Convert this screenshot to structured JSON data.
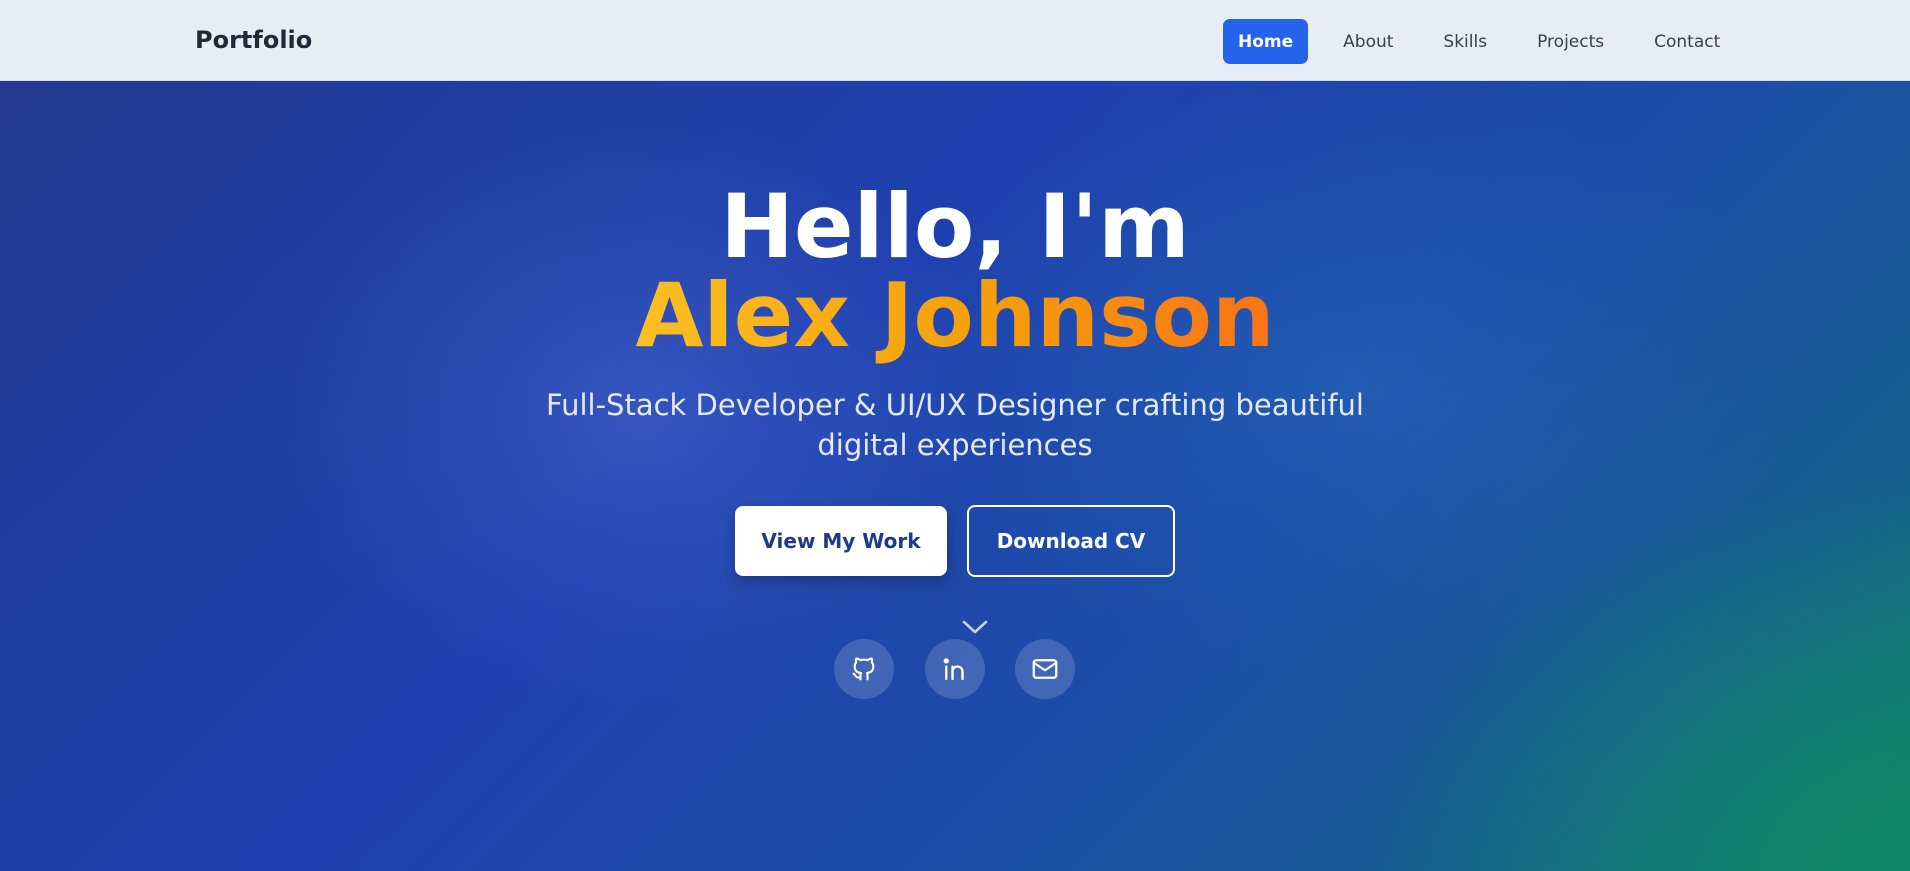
{
  "nav": {
    "brand": "Portfolio",
    "links": [
      {
        "label": "Home",
        "active": true
      },
      {
        "label": "About",
        "active": false
      },
      {
        "label": "Skills",
        "active": false
      },
      {
        "label": "Projects",
        "active": false
      },
      {
        "label": "Contact",
        "active": false
      }
    ]
  },
  "hero": {
    "greeting": "Hello, I'm",
    "name": "Alex Johnson",
    "subtitle": "Full-Stack Developer & UI/UX Designer crafting beautiful digital experiences",
    "primary_button": "View My Work",
    "secondary_button": "Download CV",
    "scroll_icon": "chevron-down-icon",
    "social": [
      {
        "icon": "github-icon"
      },
      {
        "icon": "linkedin-icon"
      },
      {
        "icon": "mail-icon"
      }
    ]
  },
  "colors": {
    "accent": "#2563eb",
    "name_gradient_start": "#fbbf24",
    "name_gradient_end": "#f97316",
    "hero_bg": "#1e40af"
  }
}
